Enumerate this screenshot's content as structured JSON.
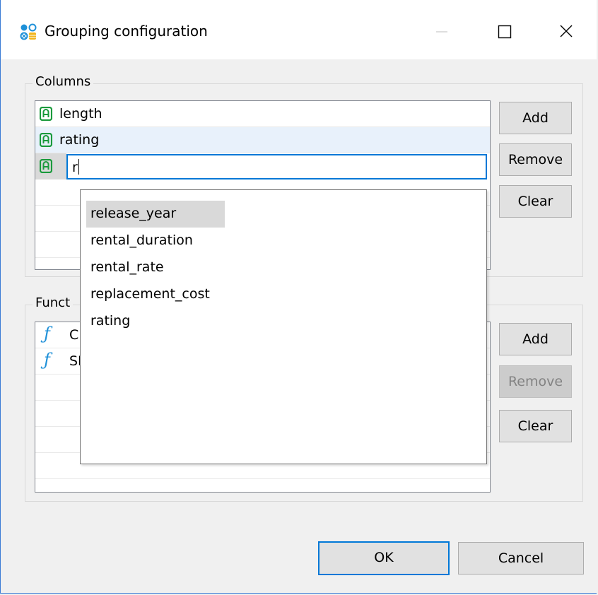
{
  "window": {
    "title": "Grouping configuration",
    "app_icon": "grouping-icon",
    "controls": [
      "minimize-icon",
      "maximize-icon",
      "close-icon"
    ]
  },
  "columns": {
    "label": "Columns",
    "items": [
      {
        "icon": "text-attribute-icon",
        "label": "length",
        "selected": false
      },
      {
        "icon": "text-attribute-icon",
        "label": "rating",
        "selected": true
      }
    ],
    "editor_value": "r",
    "buttons": {
      "add": "Add",
      "remove": "Remove",
      "clear": "Clear"
    }
  },
  "functions": {
    "label": "Funct",
    "items": [
      {
        "icon": "function-icon",
        "glyph": "ƒ",
        "label": "C"
      },
      {
        "icon": "function-icon",
        "glyph": "ƒ",
        "label": "SI"
      }
    ],
    "buttons": {
      "add": "Add",
      "remove": "Remove",
      "clear": "Clear"
    },
    "remove_enabled": false
  },
  "autocomplete": {
    "options": [
      "release_year",
      "rental_duration",
      "rental_rate",
      "replacement_cost",
      "rating"
    ],
    "highlighted_index": 0
  },
  "footer": {
    "ok": "OK",
    "cancel": "Cancel"
  },
  "colors": {
    "accent": "#0078d7",
    "attribute_icon": "#1a9a3c",
    "function_icon": "#1e90d8"
  }
}
